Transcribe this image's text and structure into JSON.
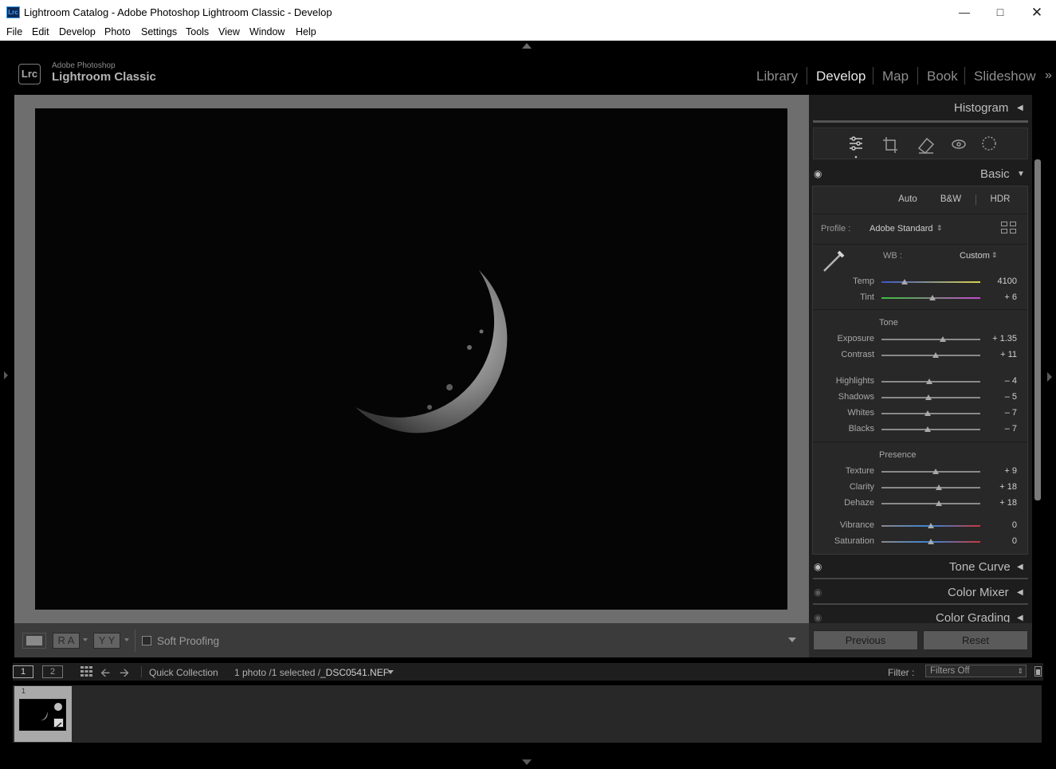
{
  "window": {
    "title": "Lightroom Catalog - Adobe Photoshop Lightroom Classic - Develop",
    "icon": "Lrc",
    "controls": [
      "minimize-icon",
      "maximize-icon",
      "close-icon"
    ]
  },
  "menu": [
    "File",
    "Edit",
    "Develop",
    "Photo",
    "Settings",
    "Tools",
    "View",
    "Window",
    "Help"
  ],
  "brand": {
    "logo": "Lrc",
    "line1": "Adobe Photoshop",
    "line2": "Lightroom Classic"
  },
  "modules": [
    "Library",
    "Develop",
    "Map",
    "Book",
    "Slideshow"
  ],
  "active_module": "Develop",
  "panels": {
    "histogram": "Histogram",
    "basic": "Basic",
    "tone_curve": "Tone Curve",
    "color_mixer": "Color Mixer",
    "color_grading": "Color Grading"
  },
  "basic": {
    "buttons": [
      "Auto",
      "B&W",
      "HDR"
    ],
    "profile_label": "Profile :",
    "profile_value": "Adobe Standard",
    "wb_label": "WB :",
    "wb_value": "Custom",
    "tone_header": "Tone",
    "presence_header": "Presence",
    "sliders": [
      {
        "label": "Temp",
        "value": "4100",
        "pos": 0.23
      },
      {
        "label": "Tint",
        "value": "+ 6",
        "pos": 0.52
      },
      {
        "label": "Exposure",
        "value": "+ 1.35",
        "pos": 0.62
      },
      {
        "label": "Contrast",
        "value": "+ 11",
        "pos": 0.55
      },
      {
        "label": "Highlights",
        "value": "– 4",
        "pos": 0.48
      },
      {
        "label": "Shadows",
        "value": "– 5",
        "pos": 0.475
      },
      {
        "label": "Whites",
        "value": "– 7",
        "pos": 0.465
      },
      {
        "label": "Blacks",
        "value": "– 7",
        "pos": 0.465
      },
      {
        "label": "Texture",
        "value": "+ 9",
        "pos": 0.545
      },
      {
        "label": "Clarity",
        "value": "+ 18",
        "pos": 0.58
      },
      {
        "label": "Dehaze",
        "value": "+ 18",
        "pos": 0.58
      },
      {
        "label": "Vibrance",
        "value": "0",
        "pos": 0.5
      },
      {
        "label": "Saturation",
        "value": "0",
        "pos": 0.5
      }
    ]
  },
  "toolbar": {
    "soft_proofing": "Soft Proofing",
    "ra": "R A",
    "yy": "Y Y"
  },
  "buttons": {
    "previous": "Previous",
    "reset": "Reset"
  },
  "filmstrip": {
    "screen1": "1",
    "screen2": "2",
    "source": "Quick Collection",
    "info": "1 photo /1 selected /",
    "filename": "_DSC0541.NEF",
    "filter_label": "Filter :",
    "filter_value": "Filters Off",
    "thumb_index": "1"
  }
}
